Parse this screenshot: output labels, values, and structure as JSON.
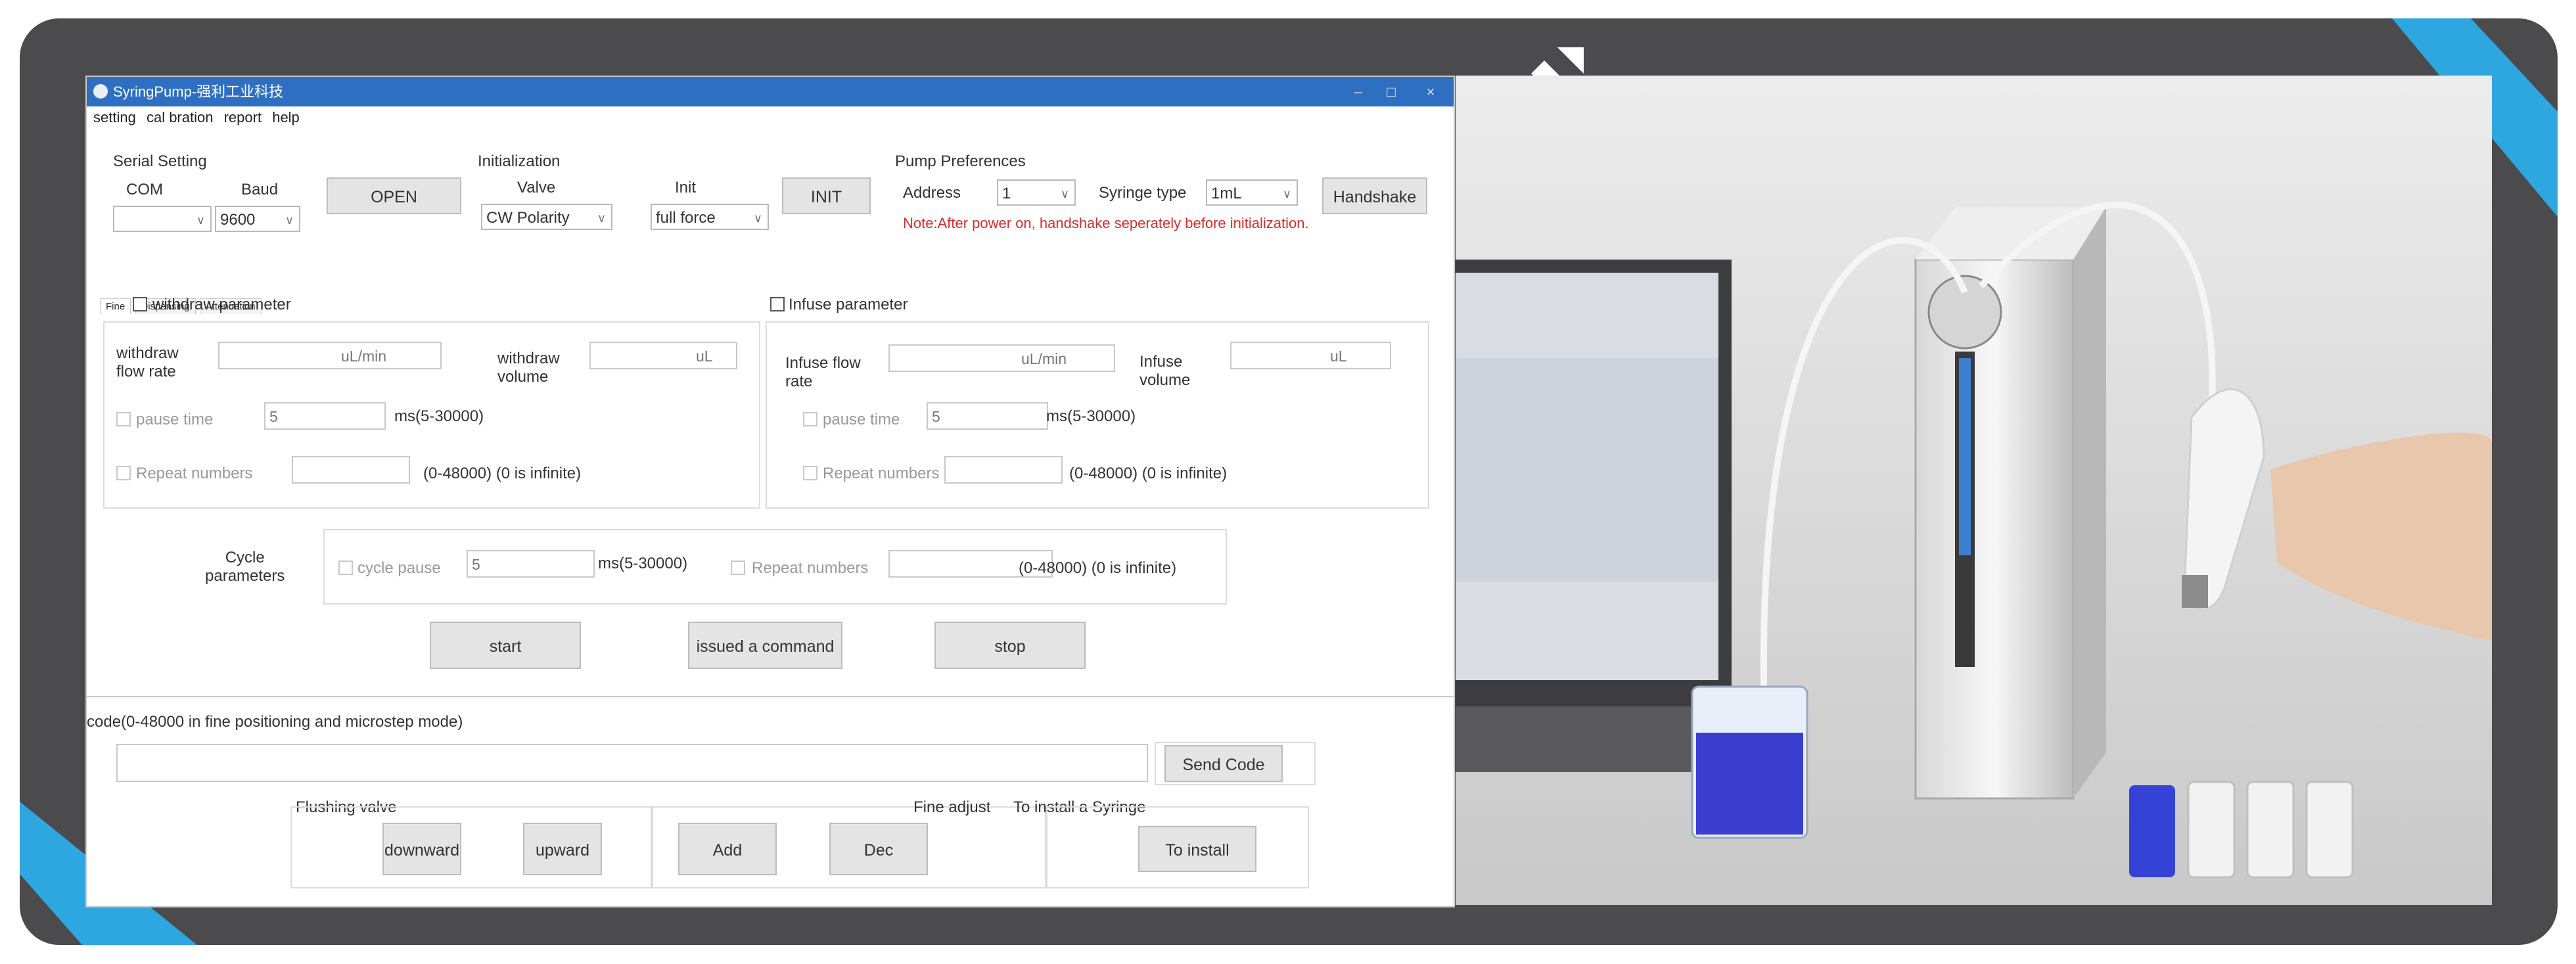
{
  "window": {
    "title": "SyringPump-强利工业科技",
    "controls": [
      "–",
      "□",
      "×"
    ]
  },
  "menu": {
    "items": [
      "setting",
      "cal bration",
      "report",
      "help"
    ]
  },
  "serial": {
    "group_label": "Serial Setting",
    "com_label": "COM",
    "baud_label": "Baud",
    "com_value": "",
    "baud_value": "9600",
    "open_label": "OPEN"
  },
  "init": {
    "group_label": "Initialization",
    "valve_label": "Valve",
    "init_label": "Init",
    "valve_value": "CW Polarity",
    "init_value": "full force",
    "init_button": "INIT"
  },
  "pump": {
    "group_label": "Pump Preferences",
    "address_label": "Address",
    "address_value": "1",
    "syringe_label": "Syringe type",
    "syringe_value": "1mL",
    "handshake_label": "Handshake",
    "note": "Note:After power on, handshake seperately before initialization."
  },
  "tabs": [
    "Fine",
    "Dispensing",
    "Attenuation"
  ],
  "withdraw": {
    "checkbox_label": "withdraw parameter",
    "flow_label_1": "withdraw",
    "flow_label_2": "flow rate",
    "flow_unit": "uL/min",
    "volume_label_1": "withdraw",
    "volume_label_2": "volume",
    "volume_unit": "uL",
    "pause_label": "pause time",
    "pause_value": "5",
    "pause_range": "ms(5-30000)",
    "repeat_label": "Repeat numbers",
    "repeat_range": "(0-48000) (0 is infinite)"
  },
  "infuse": {
    "checkbox_label": "Infuse parameter",
    "flow_label_1": "Infuse flow",
    "flow_label_2": "rate",
    "flow_unit": "uL/min",
    "volume_label_1": "Infuse",
    "volume_label_2": "volume",
    "volume_unit": "uL",
    "pause_label": "pause time",
    "pause_value": "5",
    "pause_range": "ms(5-30000)",
    "repeat_label": "Repeat numbers",
    "repeat_range": "(0-48000) (0 is infinite)"
  },
  "cycle": {
    "label_1": "Cycle",
    "label_2": "parameters",
    "pause_label": "cycle pause",
    "pause_value": "5",
    "pause_range": "ms(5-30000)",
    "repeat_label": "Repeat numbers",
    "repeat_range": "(0-48000) (0 is infinite)"
  },
  "actions": {
    "start": "start",
    "issue": "issued a command",
    "stop": "stop"
  },
  "code": {
    "label": "code(0-48000 in fine positioning and microstep mode)",
    "value": "",
    "send_label": "Send Code"
  },
  "bottom": {
    "flushing_label": "Flushing valve",
    "downward": "downward",
    "upward": "upward",
    "fine_adjust_label": "Fine adjust",
    "add": "Add",
    "dec": "Dec",
    "install_label": "To install a Syringe",
    "install_button": "To install"
  },
  "colors": {
    "titlebar": "#2f6fc2",
    "border": "#4b4b4d",
    "accent": "#2ea7e0",
    "note": "#d62b2b"
  }
}
